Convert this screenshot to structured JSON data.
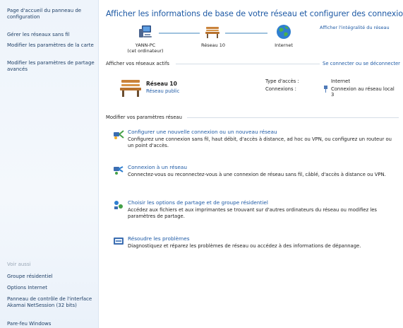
{
  "sidebar": {
    "links": [
      "Page d'accueil du panneau de configuration",
      "Gérer les réseaux sans fil",
      "Modifier les paramètres de la carte",
      "Modifier les paramètres de partage avancés"
    ],
    "see_also_label": "Voir aussi",
    "see_also": [
      "Groupe résidentiel",
      "Options Internet",
      "Panneau de contrôle de l'interface Akamai NetSession (32 bits)",
      "Pare-feu Windows"
    ]
  },
  "main": {
    "title": "Afficher les informations de base de votre réseau et configurer des connexions",
    "full_map_link": "Afficher l'intégralité du réseau",
    "map": {
      "computer_name": "YANN-PC",
      "computer_sub": "(cet ordinateur)",
      "network": "Réseau 10",
      "internet": "Internet"
    },
    "active_networks": {
      "heading": "Afficher vos réseaux actifs",
      "connect_link": "Se connecter ou se déconnecter",
      "network_name": "Réseau 10",
      "network_type": "Réseau public",
      "access_type_label": "Type d'accès :",
      "access_type_value": "Internet",
      "connections_label": "Connexions :",
      "connections_value_line1": "Connexion au réseau local",
      "connections_value_line2": "3"
    },
    "modify": {
      "heading": "Modifier vos paramètres réseau",
      "tasks": [
        {
          "title": "Configurer une nouvelle connexion ou un nouveau réseau",
          "desc": "Configurez une connexion sans fil, haut débit, d'accès à distance, ad hoc ou VPN, ou configurez un routeur ou un point d'accès."
        },
        {
          "title": "Connexion à un réseau",
          "desc": "Connectez-vous ou reconnectez-vous à une connexion de réseau sans fil, câblé, d'accès à distance ou VPN."
        },
        {
          "title": "Choisir les options de partage et de groupe résidentiel",
          "desc": "Accédez aux fichiers et aux imprimantes se trouvant sur d'autres ordinateurs du réseau ou modifiez les paramètres de partage."
        },
        {
          "title": "Résoudre les problèmes",
          "desc": "Diagnostiquez et réparez les problèmes de réseau ou accédez à des informations de dépannage."
        }
      ]
    }
  },
  "colors": {
    "link": "#1e5aa5",
    "sidebar_bg": "#eef4fb",
    "line": "#9fc2de"
  }
}
